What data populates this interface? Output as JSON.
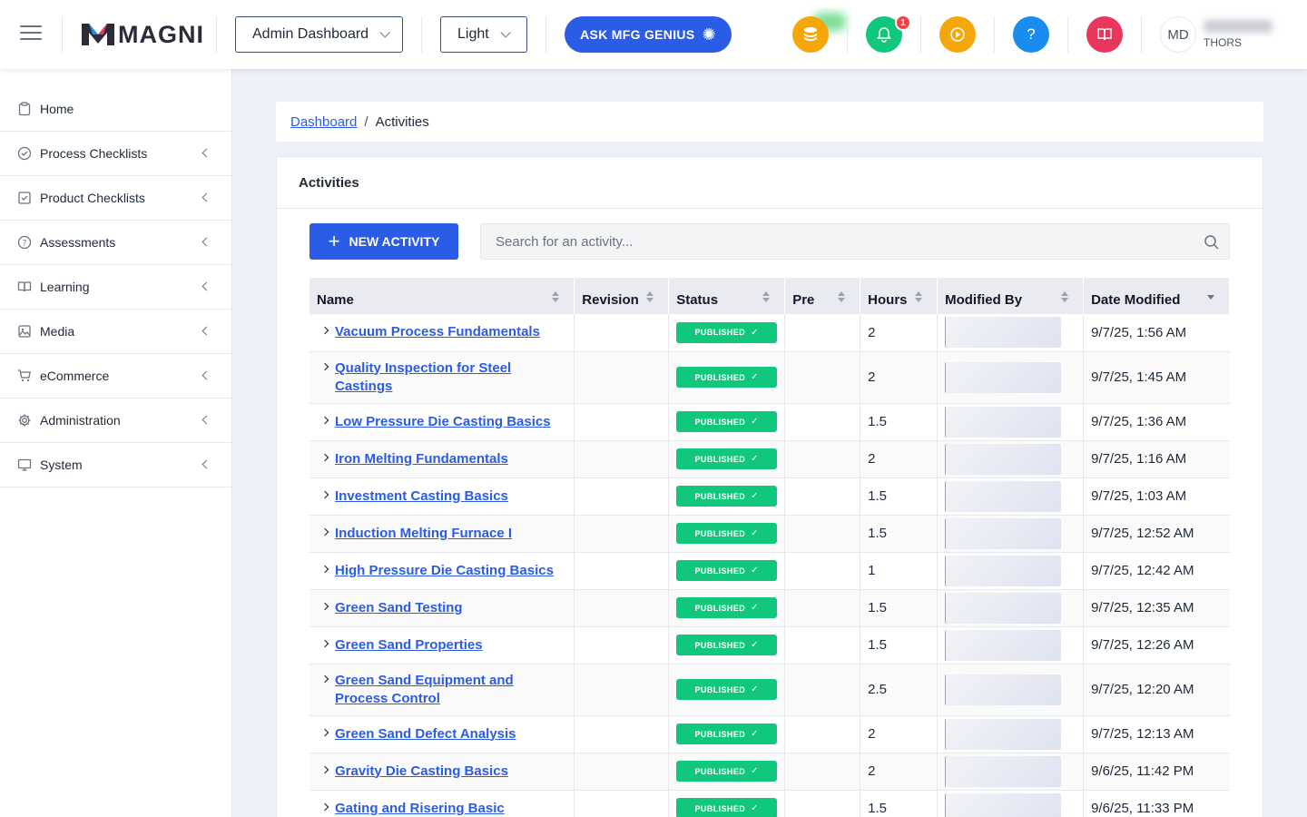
{
  "header": {
    "logo_text": "MAGNI",
    "dashboard_select": "Admin Dashboard",
    "theme_select": "Light",
    "ask_button": "ASK MFG GENIUS",
    "notification_count": "1",
    "avatar_initials": "MD",
    "user_org": "THORS"
  },
  "sidebar": {
    "items": [
      {
        "label": "Home",
        "icon": "clipboard-icon"
      },
      {
        "label": "Process Checklists",
        "icon": "check-circle-icon"
      },
      {
        "label": "Product Checklists",
        "icon": "check-square-icon"
      },
      {
        "label": "Assessments",
        "icon": "question-circle-icon"
      },
      {
        "label": "Learning",
        "icon": "book-icon"
      },
      {
        "label": "Media",
        "icon": "image-icon"
      },
      {
        "label": "eCommerce",
        "icon": "cart-icon"
      },
      {
        "label": "Administration",
        "icon": "gear-icon"
      },
      {
        "label": "System",
        "icon": "monitor-icon"
      }
    ]
  },
  "breadcrumb": {
    "parent": "Dashboard",
    "separator": "/",
    "current": "Activities"
  },
  "activities": {
    "title": "Activities",
    "new_button": "NEW ACTIVITY",
    "search_placeholder": "Search for an activity...",
    "columns": [
      "Name",
      "Revision",
      "Status",
      "Pre",
      "Hours",
      "Modified By",
      "Date Modified"
    ],
    "status_label": "PUBLISHED",
    "rows": [
      {
        "name": "Vacuum Process Fundamentals",
        "revision": "",
        "pre": "",
        "hours": "2",
        "date": "9/7/25, 1:56 AM"
      },
      {
        "name": "Quality Inspection for Steel Castings",
        "revision": "",
        "pre": "",
        "hours": "2",
        "date": "9/7/25, 1:45 AM"
      },
      {
        "name": "Low Pressure Die Casting Basics",
        "revision": "",
        "pre": "",
        "hours": "1.5",
        "date": "9/7/25, 1:36 AM"
      },
      {
        "name": "Iron Melting Fundamentals",
        "revision": "",
        "pre": "",
        "hours": "2",
        "date": "9/7/25, 1:16 AM"
      },
      {
        "name": "Investment Casting Basics",
        "revision": "",
        "pre": "",
        "hours": "1.5",
        "date": "9/7/25, 1:03 AM"
      },
      {
        "name": "Induction Melting Furnace I",
        "revision": "",
        "pre": "",
        "hours": "1.5",
        "date": "9/7/25, 12:52 AM"
      },
      {
        "name": "High Pressure Die Casting Basics",
        "revision": "",
        "pre": "",
        "hours": "1",
        "date": "9/7/25, 12:42 AM"
      },
      {
        "name": "Green Sand Testing",
        "revision": "",
        "pre": "",
        "hours": "1.5",
        "date": "9/7/25, 12:35 AM"
      },
      {
        "name": "Green Sand Properties",
        "revision": "",
        "pre": "",
        "hours": "1.5",
        "date": "9/7/25, 12:26 AM"
      },
      {
        "name": "Green Sand Equipment and Process Control",
        "revision": "",
        "pre": "",
        "hours": "2.5",
        "date": "9/7/25, 12:20 AM"
      },
      {
        "name": "Green Sand Defect Analysis",
        "revision": "",
        "pre": "",
        "hours": "2",
        "date": "9/7/25, 12:13 AM"
      },
      {
        "name": "Gravity Die Casting Basics",
        "revision": "",
        "pre": "",
        "hours": "2",
        "date": "9/6/25, 11:42 PM"
      },
      {
        "name": "Gating and Risering Basic",
        "revision": "",
        "pre": "",
        "hours": "1.5",
        "date": "9/6/25, 11:33 PM"
      }
    ]
  },
  "colors": {
    "primary": "#2b5ce6",
    "published": "#11c77b",
    "coins": "#f5a70a",
    "bell": "#11c77b",
    "play": "#f5a70a",
    "help": "#1a8cf0",
    "book": "#e8365d"
  }
}
